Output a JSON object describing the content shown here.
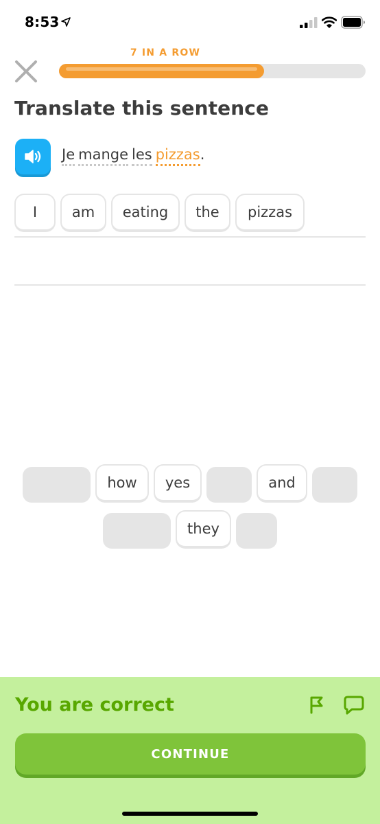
{
  "status_bar": {
    "time": "8:53",
    "icons": [
      "location-arrow-icon",
      "cellular-signal-icon",
      "wifi-icon",
      "battery-icon"
    ]
  },
  "header": {
    "close_icon": "close-icon",
    "streak_label": "7 IN A ROW",
    "progress": 0.67
  },
  "title": "Translate this sentence",
  "prompt": {
    "speaker_icon": "speaker-icon",
    "words": [
      "Je",
      "mange",
      "les",
      "pizzas"
    ],
    "new_word": "pizzas",
    "punctuation": "."
  },
  "answer": {
    "tokens": [
      "I",
      "am",
      "eating",
      "the",
      "pizzas"
    ]
  },
  "word_bank": {
    "row1": [
      "",
      "how",
      "yes",
      "",
      "and",
      ""
    ],
    "row2": [
      "",
      "they",
      ""
    ]
  },
  "feedback": {
    "message": "You are correct",
    "report_icon": "flag-icon",
    "discuss_icon": "comment-icon",
    "continue_label": "CONTINUE"
  },
  "colors": {
    "accent_orange": "#f49c31",
    "speaker_blue": "#1cb0f6",
    "success_bg": "#c4f09d",
    "success_text": "#58a700",
    "continue_green": "#7fc43a",
    "slot_gray": "#e5e5e5"
  }
}
